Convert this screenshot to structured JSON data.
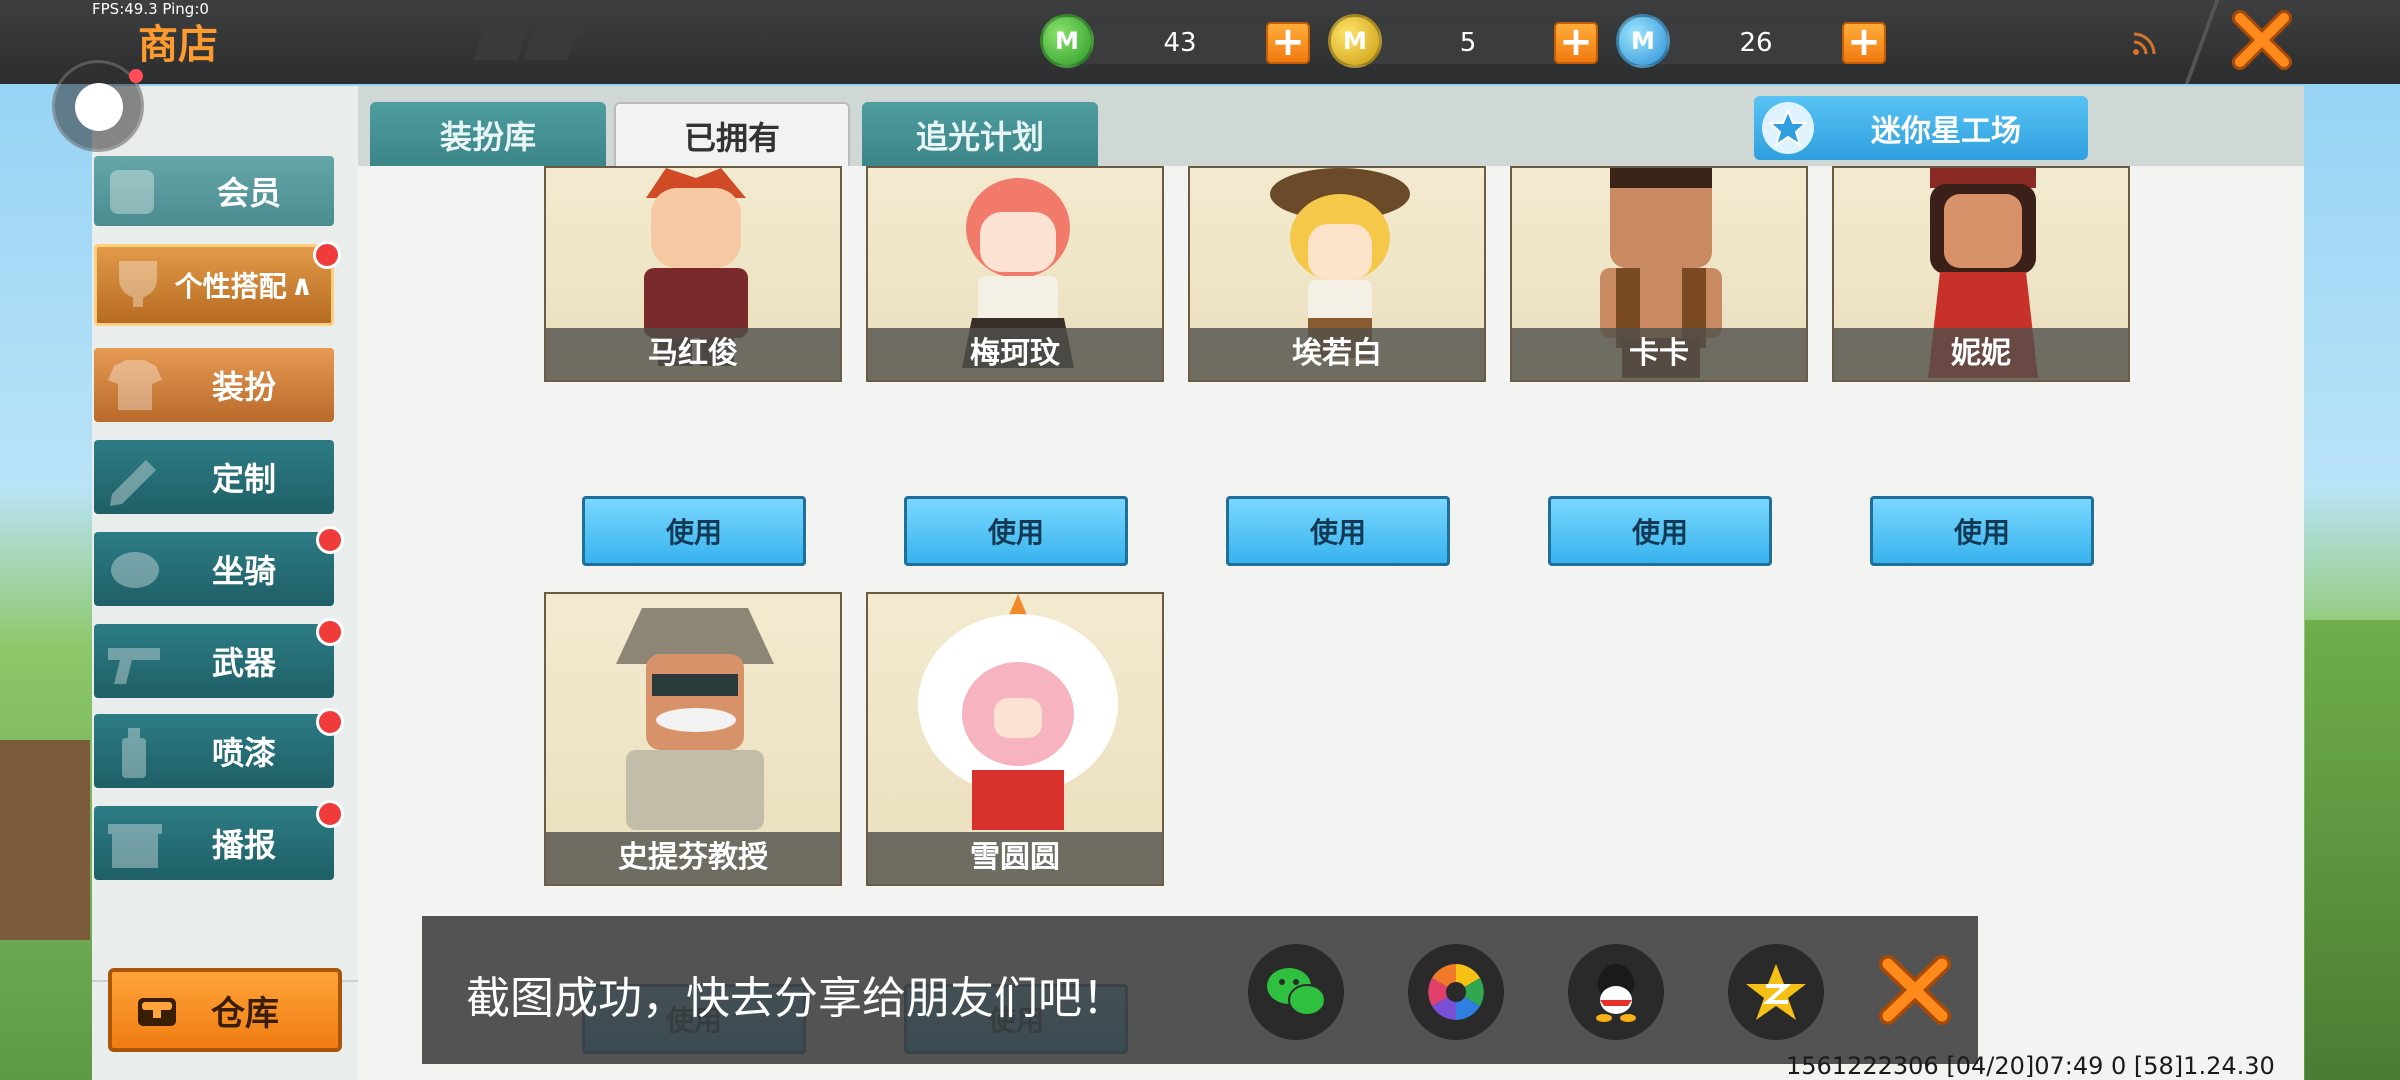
{
  "status": {
    "fps_text": "FPS:49.3  Ping:0"
  },
  "header": {
    "title": "商店"
  },
  "currencies": [
    {
      "icon": "green-mini-coin-icon",
      "symbol": "M",
      "value": "43"
    },
    {
      "icon": "gold-mini-coin-icon",
      "symbol": "M",
      "value": "5"
    },
    {
      "icon": "blue-mini-coin-icon",
      "symbol": "M",
      "value": "26"
    }
  ],
  "sidebar": {
    "member": "会员",
    "category": "个性搭配",
    "items": [
      {
        "label": "装扮",
        "active": true,
        "badge": false
      },
      {
        "label": "定制",
        "active": false,
        "badge": false
      },
      {
        "label": "坐骑",
        "active": false,
        "badge": true
      },
      {
        "label": "武器",
        "active": false,
        "badge": true
      },
      {
        "label": "喷漆",
        "active": false,
        "badge": true
      },
      {
        "label": "播报",
        "active": false,
        "badge": true
      }
    ],
    "warehouse": "仓库"
  },
  "tabs": [
    {
      "label": "装扮库",
      "active": false
    },
    {
      "label": "已拥有",
      "active": true
    },
    {
      "label": "追光计划",
      "active": false
    }
  ],
  "workshop_button": "迷你星工场",
  "skins": [
    {
      "name": "马红俊",
      "use": "使用"
    },
    {
      "name": "梅珂玟",
      "use": "使用"
    },
    {
      "name": "埃若白",
      "use": "使用"
    },
    {
      "name": "卡卡",
      "use": "使用"
    },
    {
      "name": "妮妮",
      "use": "使用"
    },
    {
      "name": "史提芬教授",
      "use": "使用"
    },
    {
      "name": "雪圆圆",
      "use": "使用"
    }
  ],
  "toast": {
    "message": "截图成功，快去分享给朋友们吧！",
    "share_targets": [
      "wechat-icon",
      "moments-icon",
      "qq-icon",
      "qzone-icon"
    ]
  },
  "footer": {
    "id_text": "1561222306    [04/20]07:49 0 [58]1.24.30"
  },
  "colors": {
    "accent_orange": "#ef7c12",
    "teal": "#2d7c84",
    "use_blue": "#38b3ee",
    "badge_red": "#f03b3b"
  }
}
